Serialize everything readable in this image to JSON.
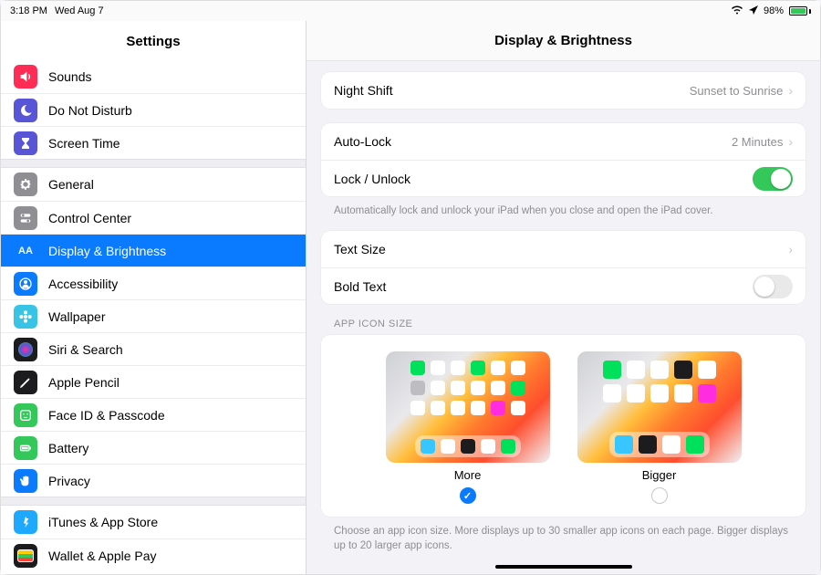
{
  "status": {
    "time": "3:18 PM",
    "date": "Wed Aug 7",
    "battery_pct": "98%"
  },
  "sidebar": {
    "title": "Settings",
    "groups": [
      [
        {
          "id": "sounds",
          "label": "Sounds",
          "icon": "speaker",
          "bg": "#ff2d55"
        },
        {
          "id": "dnd",
          "label": "Do Not Disturb",
          "icon": "moon",
          "bg": "#5856d6"
        },
        {
          "id": "screentime",
          "label": "Screen Time",
          "icon": "hourglass",
          "bg": "#5856d6"
        }
      ],
      [
        {
          "id": "general",
          "label": "General",
          "icon": "gear",
          "bg": "#8e8e93"
        },
        {
          "id": "controlcenter",
          "label": "Control Center",
          "icon": "switches",
          "bg": "#8e8e93"
        },
        {
          "id": "display",
          "label": "Display & Brightness",
          "icon": "aa",
          "bg": "#0a7aff",
          "selected": true
        },
        {
          "id": "accessibility",
          "label": "Accessibility",
          "icon": "person",
          "bg": "#0a7aff"
        },
        {
          "id": "wallpaper",
          "label": "Wallpaper",
          "icon": "flower",
          "bg": "#39c4e6"
        },
        {
          "id": "siri",
          "label": "Siri & Search",
          "icon": "siri",
          "bg": "#1c1c1e"
        },
        {
          "id": "pencil",
          "label": "Apple Pencil",
          "icon": "pencil",
          "bg": "#1c1c1e"
        },
        {
          "id": "faceid",
          "label": "Face ID & Passcode",
          "icon": "face",
          "bg": "#34c759"
        },
        {
          "id": "battery",
          "label": "Battery",
          "icon": "battery",
          "bg": "#34c759"
        },
        {
          "id": "privacy",
          "label": "Privacy",
          "icon": "hand",
          "bg": "#0a7aff"
        }
      ],
      [
        {
          "id": "appstore",
          "label": "iTunes & App Store",
          "icon": "appstore",
          "bg": "#1fa8ff"
        },
        {
          "id": "wallet",
          "label": "Wallet & Apple Pay",
          "icon": "wallet",
          "bg": "#1c1c1e"
        }
      ]
    ]
  },
  "detail": {
    "title": "Display & Brightness",
    "nightshift": {
      "label": "Night Shift",
      "value": "Sunset to Sunrise"
    },
    "autolock": {
      "label": "Auto-Lock",
      "value": "2 Minutes"
    },
    "lockunlock": {
      "label": "Lock / Unlock",
      "on": true
    },
    "lockunlock_note": "Automatically lock and unlock your iPad when you close and open the iPad cover.",
    "textsize": {
      "label": "Text Size"
    },
    "boldtext": {
      "label": "Bold Text",
      "on": false
    },
    "iconsize": {
      "header": "APP ICON SIZE",
      "options": [
        {
          "id": "more",
          "label": "More",
          "selected": true
        },
        {
          "id": "bigger",
          "label": "Bigger",
          "selected": false
        }
      ],
      "note": "Choose an app icon size. More displays up to 30 smaller app icons on each page. Bigger displays up to 20 larger app icons."
    }
  },
  "icon_colors": {
    "more_grid": [
      "#00e05a",
      "#ffffff",
      "#ffffff",
      "#00e05a",
      "#ffffff",
      "#ffffff",
      "#bdbdc2",
      "#ffffff",
      "#ffffff",
      "#ffffff",
      "#ffffff",
      "#00e05a",
      "#ffffff",
      "#ffffff",
      "#ffffff",
      "#ffffff",
      "#ff2ddf",
      "#ffffff"
    ],
    "more_dock": [
      "#38c6ff",
      "#ffffff",
      "#1c1c1e",
      "#ffffff",
      "#00e05a"
    ],
    "bigger_grid": [
      "#00e05a",
      "#ffffff",
      "#ffffff",
      "#1c1c1e",
      "#ffffff",
      "#ffffff",
      "#ffffff",
      "#ffffff",
      "#ffffff",
      "#ff2ddf"
    ],
    "bigger_dock": [
      "#38c6ff",
      "#1c1c1e",
      "#ffffff",
      "#00e05a"
    ]
  }
}
